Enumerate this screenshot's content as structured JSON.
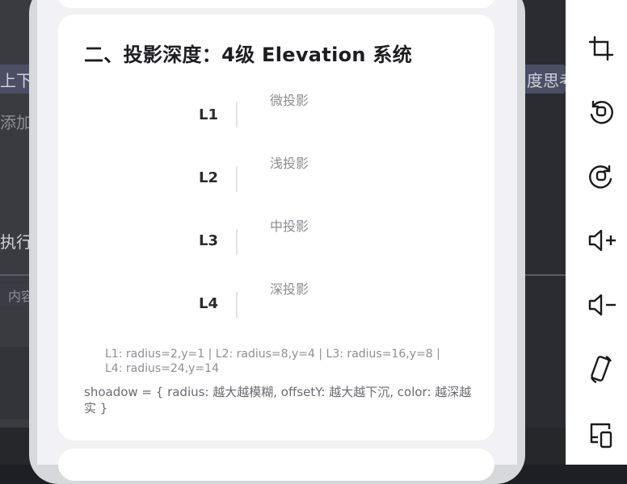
{
  "background": {
    "left_fragments": [
      "上下",
      "添加",
      "执行",
      "内容"
    ],
    "right_fragment": "度思考"
  },
  "card": {
    "title": "二、投影深度：4级 Elevation 系统",
    "levels": [
      {
        "label": "L1",
        "caption": "微投影"
      },
      {
        "label": "L2",
        "caption": "浅投影"
      },
      {
        "label": "L3",
        "caption": "中投影"
      },
      {
        "label": "L4",
        "caption": "深投影"
      }
    ],
    "note": "L1: radius=2,y=1 | L2: radius=8,y=4 | L3: radius=16,y=8 | L4: radius=24,y=14",
    "summary": "shoadow = { radius: 越大越模糊, offsetY: 越大越下沉, color: 越深越实 }"
  },
  "toolbar": {
    "icons": [
      "crop-icon",
      "rotate-left-icon",
      "rotate-right-icon",
      "volume-up-icon",
      "volume-down-icon",
      "screen-rotate-icon",
      "device-icon"
    ]
  }
}
